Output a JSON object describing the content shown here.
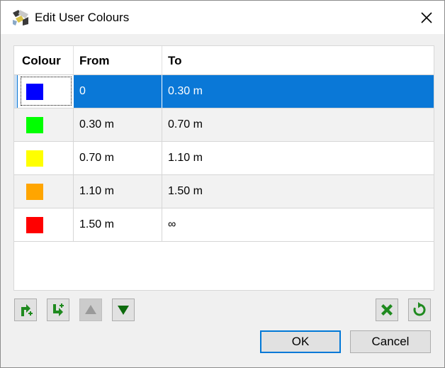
{
  "window": {
    "title": "Edit User Colours"
  },
  "table": {
    "headers": {
      "colour": "Colour",
      "from": "From",
      "to": "To"
    },
    "rows": [
      {
        "color": "#0000ff",
        "from": "0",
        "to": "0.30 m"
      },
      {
        "color": "#00ff00",
        "from": "0.30 m",
        "to": "0.70 m"
      },
      {
        "color": "#ffff00",
        "from": "0.70 m",
        "to": "1.10 m"
      },
      {
        "color": "#ffa500",
        "from": "1.10 m",
        "to": "1.50 m"
      },
      {
        "color": "#ff0000",
        "from": "1.50 m",
        "to": "∞"
      }
    ],
    "selected_row": 0
  },
  "toolbar": {
    "icons": [
      "insert-row-after-icon",
      "insert-row-before-icon",
      "move-up-icon",
      "move-down-icon",
      "delete-icon",
      "reset-icon"
    ]
  },
  "buttons": {
    "ok": "OK",
    "cancel": "Cancel"
  },
  "colors": {
    "accent": "#0a78d7",
    "icon_green": "#1f8a1f"
  }
}
